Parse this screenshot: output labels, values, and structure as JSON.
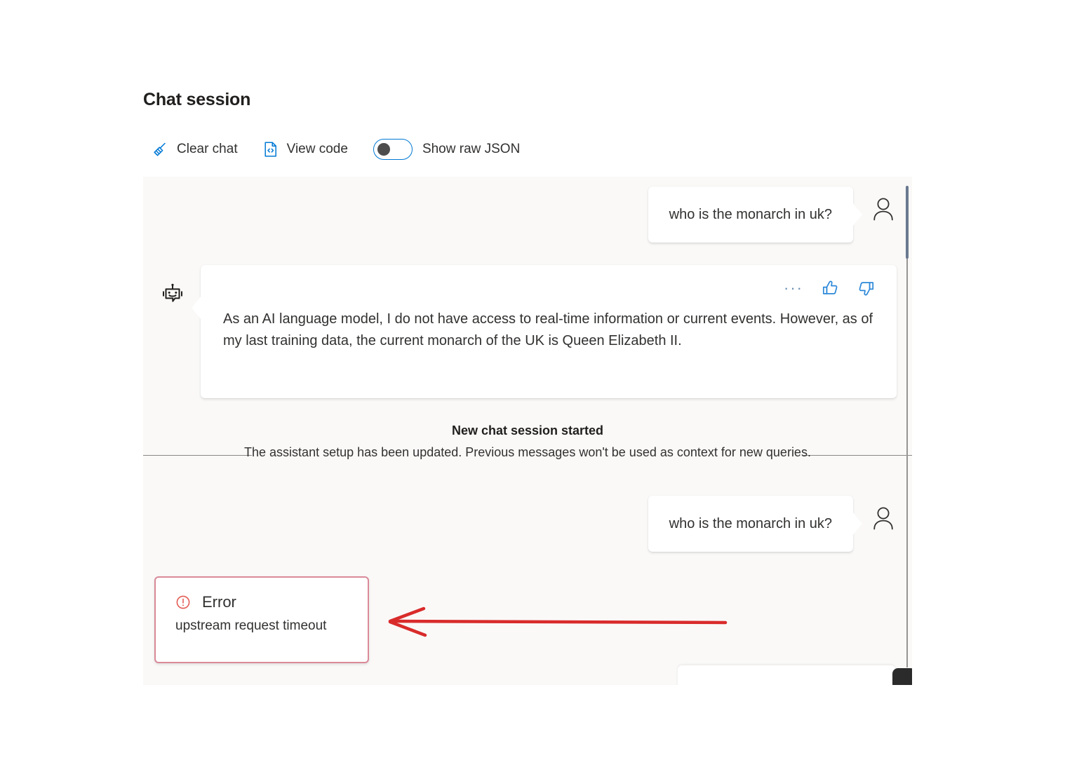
{
  "page": {
    "title": "Chat session",
    "background_color": "#ffffff",
    "panel_color": "#faf9f8",
    "accent_color": "#0078d4"
  },
  "toolbar": {
    "clear_chat": {
      "label": "Clear chat",
      "icon": "broom-icon"
    },
    "view_code": {
      "label": "View code",
      "icon": "code-file-icon"
    },
    "show_raw_json": {
      "label": "Show raw JSON",
      "icon": "toggle-switch",
      "state": "off"
    }
  },
  "messages": [
    {
      "role": "user",
      "text": "who is the monarch in uk?",
      "avatar_icon": "person-icon"
    },
    {
      "role": "assistant",
      "text": "As an AI language model, I do not have access to real-time information or current events. However, as of my last training data, the current monarch of the UK is Queen Elizabeth II.",
      "avatar_icon": "robot-icon",
      "actions": [
        {
          "name": "more-options",
          "icon": "ellipsis-icon",
          "label": "···"
        },
        {
          "name": "thumbs-up",
          "icon": "thumbs-up-icon"
        },
        {
          "name": "thumbs-down",
          "icon": "thumbs-down-icon"
        }
      ]
    },
    {
      "role": "user",
      "text": "who is the monarch in uk?",
      "avatar_icon": "person-icon"
    }
  ],
  "session_divider": {
    "title": "New chat session started",
    "subtitle": "The assistant setup has been updated. Previous messages won't be used as context for new queries."
  },
  "error": {
    "title": "Error",
    "message": "upstream request timeout",
    "icon": "error-circle-icon",
    "border_color": "#d98a98",
    "icon_color": "#e35b55"
  },
  "annotation": {
    "type": "arrow",
    "direction": "left",
    "color": "#d92b2b"
  },
  "scrollbar": {
    "orientation": "vertical",
    "thumb_color": "#69798f"
  }
}
